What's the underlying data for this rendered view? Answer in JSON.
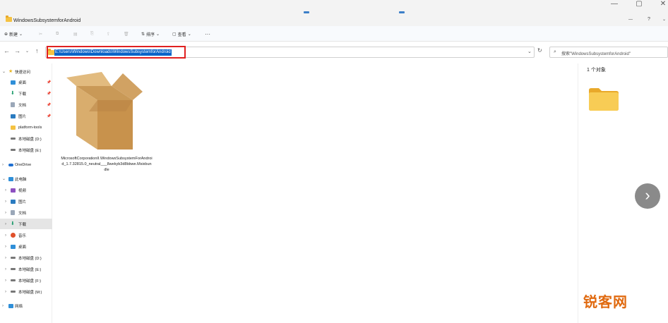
{
  "window": {
    "title": "WindowsSubsystemforAndroid"
  },
  "toolbar": {
    "new_label": "新建",
    "sort_label": "排序",
    "view_label": "查看",
    "more_label": "···"
  },
  "address": {
    "path": "E:\\Users\\Windows\\Downloads\\WindowsSubsystemforAndroid",
    "search_placeholder": "搜索\"WindowsSubsystemforAndroid\""
  },
  "sidebar": {
    "items": [
      {
        "label": "快速访问",
        "icon": "star-icon"
      },
      {
        "label": "桌面",
        "icon": "desktop-icon"
      },
      {
        "label": "下载",
        "icon": "download-icon"
      },
      {
        "label": "文档",
        "icon": "document-icon"
      },
      {
        "label": "图片",
        "icon": "picture-icon"
      },
      {
        "label": "platform-tools",
        "icon": "folder-icon"
      },
      {
        "label": "本地磁盘 (D:)",
        "icon": "drive-icon"
      },
      {
        "label": "本地磁盘 (E:)",
        "icon": "drive-icon"
      },
      {
        "label": "OneDrive",
        "icon": "cloud-icon"
      },
      {
        "label": "此电脑",
        "icon": "computer-icon"
      },
      {
        "label": "视频",
        "icon": "video-icon"
      },
      {
        "label": "图片",
        "icon": "picture-icon"
      },
      {
        "label": "文档",
        "icon": "document-icon"
      },
      {
        "label": "下载",
        "icon": "download-icon"
      },
      {
        "label": "音乐",
        "icon": "music-icon"
      },
      {
        "label": "桌面",
        "icon": "desktop-icon"
      },
      {
        "label": "本地磁盘 (D:)",
        "icon": "drive-icon"
      },
      {
        "label": "本地磁盘 (E:)",
        "icon": "drive-icon"
      },
      {
        "label": "本地磁盘 (F:)",
        "icon": "drive-icon"
      },
      {
        "label": "本地磁盘 (M:)",
        "icon": "drive-icon"
      },
      {
        "label": "网络",
        "icon": "network-icon"
      }
    ]
  },
  "file": {
    "name": "MicrosoftCorporationII.WindowsSubsystemForAndroid_1.7.32815.0_neutral___8wekyb3d8bbwe.Msixbundle"
  },
  "details": {
    "count": "1 个对象"
  },
  "watermark": {
    "text": "锐客网"
  },
  "colors": {
    "accent": "#0a64c8",
    "highlight": "#e02020",
    "folder": "#f5c242"
  }
}
